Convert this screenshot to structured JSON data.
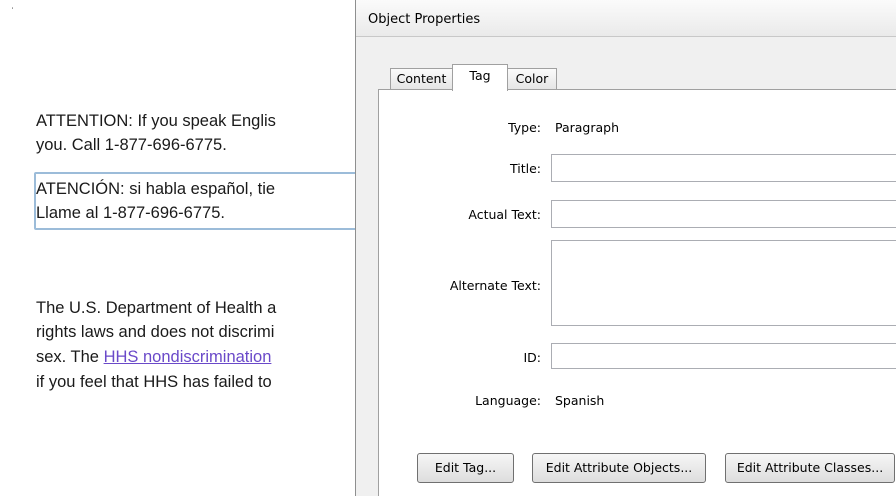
{
  "document": {
    "corner_mark": "ʾ",
    "para1_line1": "ATTENTION: If you speak Englis",
    "para1_line2": "you. Call 1-877-696-6775.",
    "para2_line1": "ATENCIÓN: si habla español, tie",
    "para2_line2": "Llame al 1-877-696-6775.",
    "para3_line1": "The U.S. Department of Health a",
    "para3_line2": "rights laws and does not discrimi",
    "para3_line3_prefix": "sex. The ",
    "para3_line3_link": "HHS nondiscrimination",
    "para3_line4": "if you feel that HHS has failed to"
  },
  "dialog": {
    "title": "Object Properties",
    "tabs": [
      {
        "label": "Content"
      },
      {
        "label": "Tag"
      },
      {
        "label": "Color"
      }
    ],
    "fields": {
      "type_label": "Type:",
      "type_value": "Paragraph",
      "title_label": "Title:",
      "title_value": "",
      "actual_text_label": "Actual Text:",
      "actual_text_value": "",
      "alternate_text_label": "Alternate Text:",
      "alternate_text_value": "",
      "id_label": "ID:",
      "id_value": "",
      "language_label": "Language:",
      "language_value": "Spanish"
    },
    "buttons": {
      "edit_tag": "Edit Tag...",
      "edit_attribute_objects": "Edit Attribute Objects...",
      "edit_attribute_classes": "Edit Attribute Classes..."
    }
  },
  "colors": {
    "link": "#6a49c9",
    "selection_border": "#9cbcd9"
  }
}
